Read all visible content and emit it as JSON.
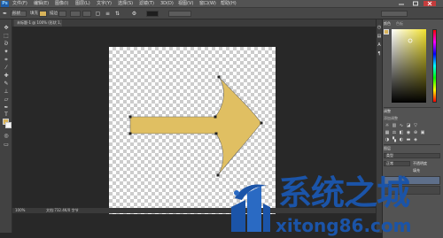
{
  "app": {
    "logo": "Ps"
  },
  "menubar": {
    "items": [
      "文件(F)",
      "编辑(E)",
      "图像(I)",
      "图层(L)",
      "文字(Y)",
      "选择(S)",
      "滤镜(T)",
      "3D(D)",
      "视图(V)",
      "窗口(W)",
      "帮助(H)"
    ]
  },
  "options": {
    "mode_label": "形状",
    "fill_label": "填充",
    "stroke_label": "描边"
  },
  "document": {
    "tab_label": "未标题-1 @ 100% (形状 1, RGB/8)",
    "zoom": "100%",
    "doc_info": "文档:732.4K/0 字节"
  },
  "panels": {
    "color_tab": "颜色",
    "swatches_tab": "色板",
    "adjust_tab": "调整",
    "adjust_sub": "添加调整",
    "layers_tab": "图层",
    "kind_label": "类型",
    "blend_label": "正常",
    "opacity_label": "不透明度",
    "fill_label": "填充"
  },
  "colors": {
    "foreground": "#d8b35a",
    "background": "#f6f6f6",
    "arrow_fill": "#e0bf62",
    "arrow_stroke": "#6a6a6a"
  },
  "watermark": {
    "title": "系统之城",
    "url": "xitong86.com"
  }
}
